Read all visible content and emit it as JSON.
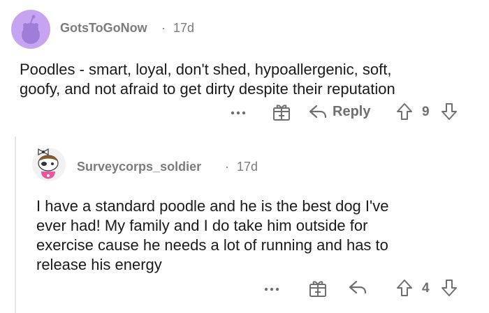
{
  "comments": [
    {
      "username": "GotsToGoNow",
      "separator": "·",
      "age": "17d",
      "body_lines": [
        "Poodles - smart, loyal, don't shed, hypoallergenic, soft,",
        "goofy, and not afraid to get dirty despite their reputation"
      ],
      "actions": {
        "more_icon": "ellipsis-icon",
        "award_icon": "gift-box-icon",
        "reply_label": "Reply",
        "score": "9"
      },
      "avatar_color": "#c6a4f2"
    },
    {
      "username": "Surveycorps_soldier",
      "separator": "·",
      "age": "17d",
      "body_lines": [
        "I have a standard poodle and he is the best dog I've",
        "ever had! My family and I do take him outside for",
        "exercise cause he needs a lot of running and has to",
        "release his energy"
      ],
      "actions": {
        "more_icon": "ellipsis-icon",
        "award_icon": "gift-box-icon",
        "reply_icon": "reply-arrow-icon",
        "score": "4"
      },
      "avatar_color": "#f4f4f4"
    }
  ]
}
